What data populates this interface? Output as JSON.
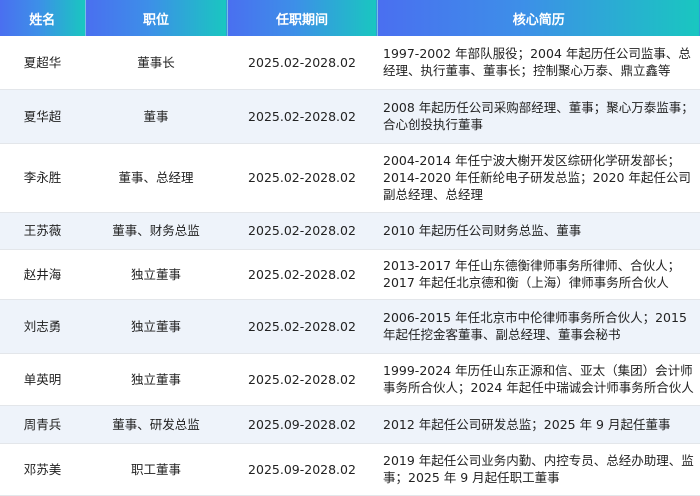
{
  "headers": [
    "姓名",
    "职位",
    "任职期间",
    "核心简历"
  ],
  "rows": [
    {
      "name": "夏超华",
      "position": "董事长",
      "period": "2025.02-2028.02",
      "bio": "1997-2002 年部队服役；2004 年起历任公司监事、总经理、执行董事、董事长；控制聚心万泰、鼎立鑫等"
    },
    {
      "name": "夏华超",
      "position": "董事",
      "period": "2025.02-2028.02",
      "bio": "2008 年起历任公司采购部经理、董事；聚心万泰监事；合心创投执行董事"
    },
    {
      "name": "李永胜",
      "position": "董事、总经理",
      "period": "2025.02-2028.02",
      "bio": "2004-2014 年任宁波大榭开发区综研化学研发部长；2014-2020 年任新纶电子研发总监；2020 年起任公司副总经理、总经理"
    },
    {
      "name": "王苏薇",
      "position": "董事、财务总监",
      "period": "2025.02-2028.02",
      "bio": "2010 年起历任公司财务总监、董事"
    },
    {
      "name": "赵井海",
      "position": "独立董事",
      "period": "2025.02-2028.02",
      "bio": "2013-2017 年任山东德衡律师事务所律师、合伙人；2017 年起任北京德和衡（上海）律师事务所合伙人"
    },
    {
      "name": "刘志勇",
      "position": "独立董事",
      "period": "2025.02-2028.02",
      "bio": "2006-2015 年任北京市中伦律师事务所合伙人；2015 年起任挖金客董事、副总经理、董事会秘书"
    },
    {
      "name": "单英明",
      "position": "独立董事",
      "period": "2025.02-2028.02",
      "bio": "1999-2024 年历任山东正源和信、亚太（集团）会计师事务所合伙人；2024 年起任中瑞诚会计师事务所合伙人"
    },
    {
      "name": "周青兵",
      "position": "董事、研发总监",
      "period": "2025.09-2028.02",
      "bio": "2012 年起任公司研发总监；2025 年 9 月起任董事"
    },
    {
      "name": "邓苏美",
      "position": "职工董事",
      "period": "2025.09-2028.02",
      "bio": "2019 年起任公司业务内勤、内控专员、总经办助理、监事；2025 年 9 月起任职工董事"
    }
  ]
}
